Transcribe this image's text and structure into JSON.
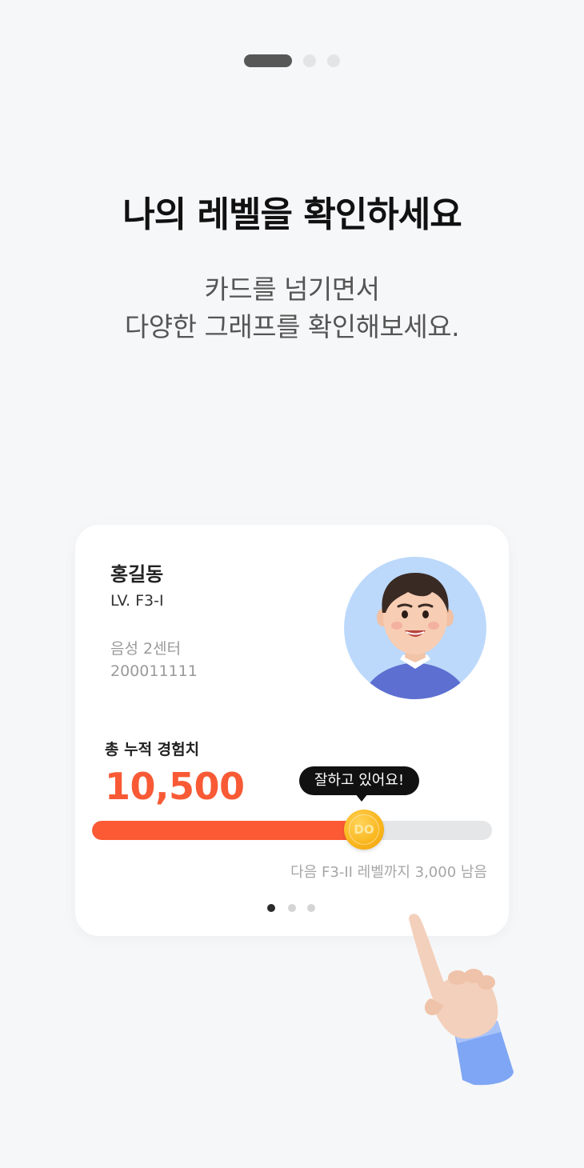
{
  "onboarding": {
    "total_pages": 3,
    "current_page": 1
  },
  "title": "나의 레벨을 확인하세요",
  "subtitle": {
    "line1": "카드를 넘기면서",
    "line2": "다양한 그래프를 확인해보세요."
  },
  "card": {
    "name": "홍길동",
    "level": "LV. F3-I",
    "center": "음성 2센터",
    "employee_no": "200011111",
    "exp_label": "총 누적 경험치",
    "exp_value": "10,500",
    "tooltip": "잘하고 있어요!",
    "progress_fraction": 0.68,
    "coin_label": "DO",
    "remaining_text": "다음 F3-II 레벨까지 3,000 남음",
    "pagination": {
      "total": 3,
      "current": 1
    }
  },
  "colors": {
    "accent": "#f85a35",
    "track": "#e5e6e8",
    "coin": "#f9b51b",
    "avatar_bg": "#bcd9fb"
  },
  "icons": {
    "avatar": "user-avatar-3d",
    "hand": "pointing-hand-icon"
  }
}
